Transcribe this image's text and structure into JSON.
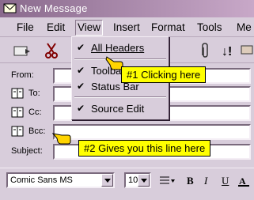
{
  "window": {
    "title": "New Message"
  },
  "menubar": {
    "items": [
      "File",
      "Edit",
      "View",
      "Insert",
      "Format",
      "Tools",
      "Me"
    ]
  },
  "header_fields": {
    "from": "From:",
    "to": "To:",
    "cc": "Cc:",
    "bcc": "Bcc:",
    "subject": "Subject:"
  },
  "view_menu": {
    "items": [
      {
        "label": "All Headers",
        "checked": true
      },
      {
        "label": "Toolbar",
        "checked": true
      },
      {
        "label": "Status Bar",
        "checked": true
      },
      {
        "label": "Source Edit",
        "checked": true
      }
    ]
  },
  "format_bar": {
    "font": "Comic Sans MS",
    "size": "10",
    "bold": "B",
    "italic": "I",
    "underline": "U"
  },
  "callouts": {
    "one": "#1 Clicking here",
    "two": "#2 Gives you this line here"
  },
  "colors": {
    "callout": "#ffff00",
    "titlebar_start": "#8a6a8d",
    "chrome": "#d8cddb"
  },
  "icons": [
    "envelope-icon",
    "send-icon",
    "cut-icon",
    "attach-icon",
    "priority-icon",
    "address-book-icon",
    "hand-pointer-icon",
    "align-icon"
  ]
}
